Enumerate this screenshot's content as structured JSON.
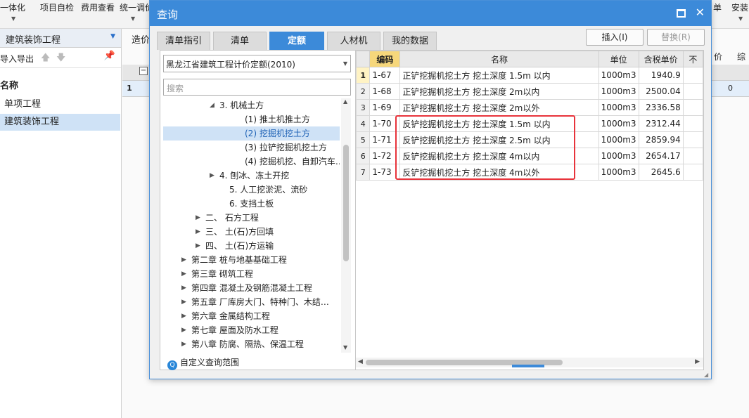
{
  "app": {
    "menu": [
      "一体化",
      "项目自检",
      "费用查看",
      "统一调价"
    ],
    "menu_right": [
      "单",
      "安装"
    ],
    "left_panel": {
      "title": "建筑装饰工程",
      "import_export": "导入导出",
      "name_header": "名称",
      "items": [
        "单项工程",
        "建筑装饰工程"
      ]
    },
    "right_bg": {
      "tab": "造价",
      "hdr1": "价",
      "hdr2": "综",
      "row_value": "0",
      "row_num": "1"
    }
  },
  "dialog": {
    "title": "查询",
    "tabs": [
      "清单指引",
      "清单",
      "定额",
      "人材机",
      "我的数据"
    ],
    "active_tab": "定额",
    "insert_label": "插入(I)",
    "replace_label": "替换(R)",
    "library": "黑龙江省建筑工程计价定额(2010)",
    "search_placeholder": "搜索",
    "custom_scope": "自定义查询范围",
    "tree": [
      {
        "label": "3. 机械土方",
        "arrow": "◢"
      },
      {
        "label": "(1) 推土机推土方",
        "arrow": ""
      },
      {
        "label": "(2) 挖掘机挖土方",
        "arrow": ""
      },
      {
        "label": "(3) 拉铲挖掘机挖土方",
        "arrow": ""
      },
      {
        "label": "(4) 挖掘机挖、自卸汽车…",
        "arrow": ""
      },
      {
        "label": "4. 刨冰、冻土开挖",
        "arrow": "▶"
      },
      {
        "label": "5. 人工挖淤泥、流砂",
        "arrow": ""
      },
      {
        "label": "6. 支挡土板",
        "arrow": ""
      },
      {
        "label": "二、 石方工程",
        "arrow": "▶"
      },
      {
        "label": "三、 土(石)方回填",
        "arrow": "▶"
      },
      {
        "label": "四、 土(石)方运输",
        "arrow": "▶"
      },
      {
        "label": "第二章 桩与地基基础工程",
        "arrow": "▶"
      },
      {
        "label": "第三章 砌筑工程",
        "arrow": "▶"
      },
      {
        "label": "第四章 混凝土及钢筋混凝土工程",
        "arrow": "▶"
      },
      {
        "label": "第五章 厂库房大门、特种门、木结…",
        "arrow": "▶"
      },
      {
        "label": "第六章 金属结构工程",
        "arrow": "▶"
      },
      {
        "label": "第七章 屋面及防水工程",
        "arrow": "▶"
      },
      {
        "label": "第八章 防腐、隔热、保温工程",
        "arrow": "▶"
      }
    ],
    "selected_tree_index": 2,
    "grid": {
      "headers": [
        "",
        "编码",
        "名称",
        "单位",
        "含税单价",
        "不"
      ],
      "rows": [
        [
          "1",
          "1-67",
          "正铲挖掘机挖土方 挖土深度 1.5m 以内",
          "1000m3",
          "1940.9"
        ],
        [
          "2",
          "1-68",
          "正铲挖掘机挖土方 挖土深度 2m以内",
          "1000m3",
          "2500.04"
        ],
        [
          "3",
          "1-69",
          "正铲挖掘机挖土方 挖土深度 2m以外",
          "1000m3",
          "2336.58"
        ],
        [
          "4",
          "1-70",
          "反铲挖掘机挖土方 挖土深度 1.5m 以内",
          "1000m3",
          "2312.44"
        ],
        [
          "5",
          "1-71",
          "反铲挖掘机挖土方 挖土深度 2.5m 以内",
          "1000m3",
          "2859.94"
        ],
        [
          "6",
          "1-72",
          "反铲挖掘机挖土方 挖土深度 4m以内",
          "1000m3",
          "2654.17"
        ],
        [
          "7",
          "1-73",
          "反铲挖掘机挖土方 挖土深度 4m以外",
          "1000m3",
          "2645.6"
        ]
      ]
    }
  },
  "colors": {
    "accent": "#3c8ad9",
    "highlight_box": "#e8333b",
    "selected_row": "#cfe2f6",
    "sort_header": "#f6d77b"
  }
}
